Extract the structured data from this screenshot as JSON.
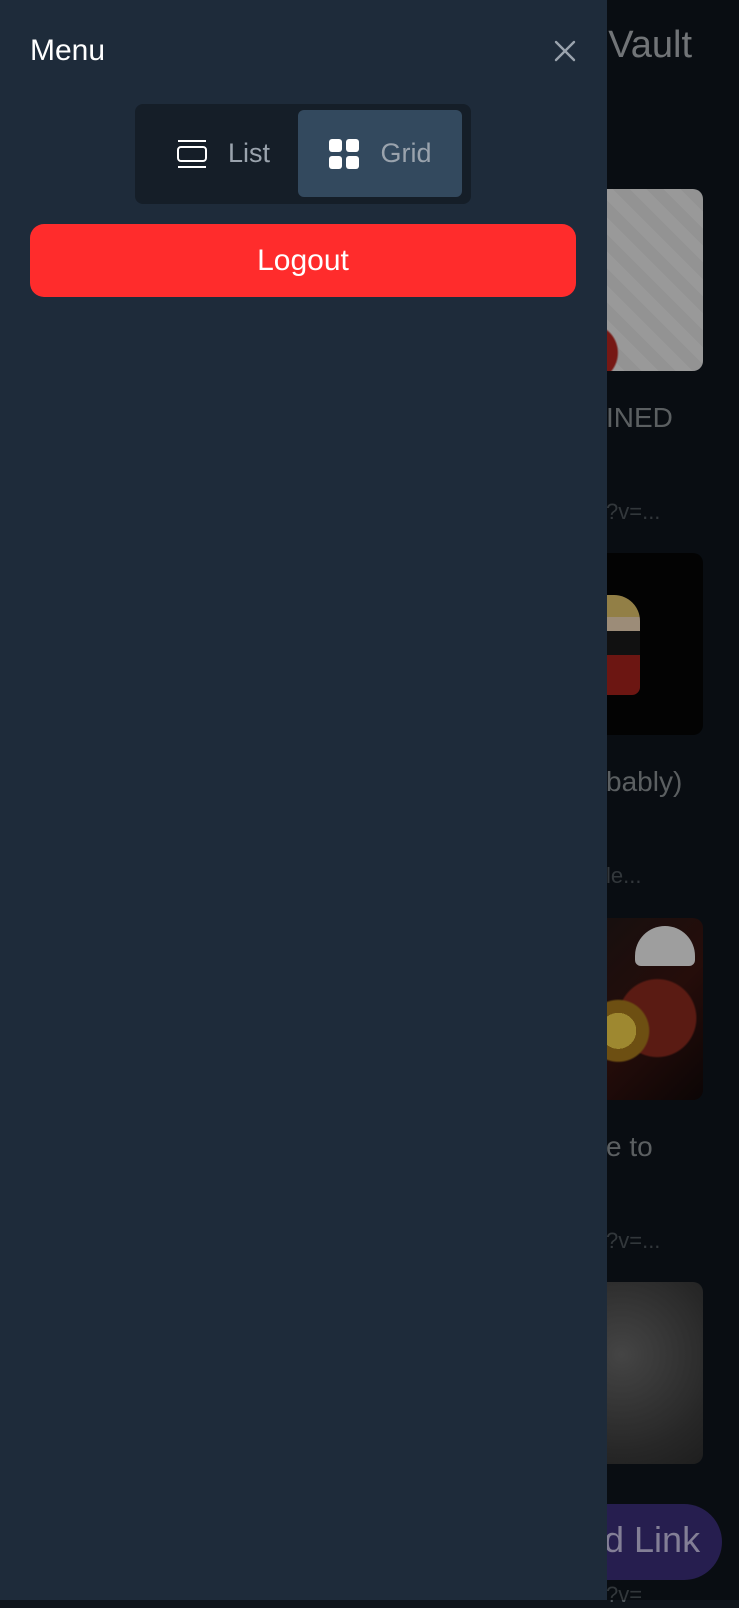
{
  "background": {
    "title": "Vault",
    "peek_texts": [
      "INED",
      "?v=...",
      "bably)",
      "le...",
      "e to",
      "?v=...",
      "d Link",
      "?v="
    ],
    "fab_label": "d Link"
  },
  "drawer": {
    "title": "Menu",
    "close_icon": "close-icon",
    "view_toggle": {
      "options": [
        {
          "label": "List",
          "icon": "list-icon",
          "selected": false
        },
        {
          "label": "Grid",
          "icon": "grid-icon",
          "selected": true
        }
      ]
    },
    "logout_label": "Logout"
  },
  "colors": {
    "drawer_bg": "#1e2b3a",
    "toggle_bg": "#151e28",
    "toggle_selected": "#33495e",
    "logout": "#ff2c2c"
  }
}
